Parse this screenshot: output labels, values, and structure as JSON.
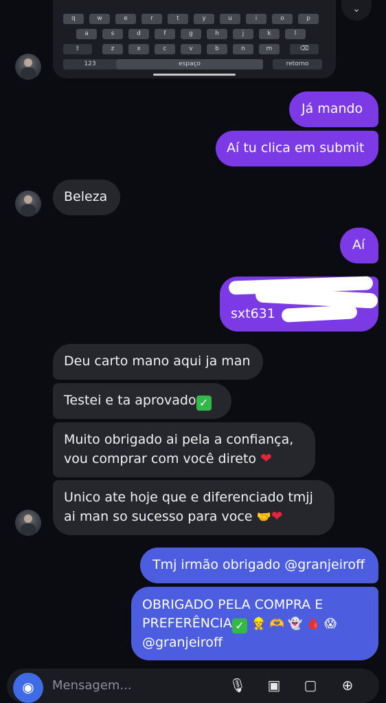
{
  "keyboard": {
    "row1": [
      "q",
      "w",
      "e",
      "r",
      "t",
      "y",
      "u",
      "i",
      "o",
      "p"
    ],
    "row2": [
      "a",
      "s",
      "d",
      "f",
      "g",
      "h",
      "j",
      "k",
      "l"
    ],
    "row3": [
      "z",
      "x",
      "c",
      "v",
      "b",
      "n",
      "m"
    ],
    "shift": "⇧",
    "backspace": "⌫",
    "numbers": "123",
    "space": "espaço",
    "return": "retorno"
  },
  "top_arrow": "⌄",
  "messages": [
    {
      "id": "m1",
      "side": "sent",
      "text": "Já mando"
    },
    {
      "id": "m2",
      "side": "sent",
      "text": "Aí tu clica em submit"
    },
    {
      "id": "m3",
      "side": "received",
      "text": "Beleza"
    },
    {
      "id": "m4",
      "side": "sent",
      "text": "Aí"
    },
    {
      "id": "m5",
      "side": "sent",
      "text_visible": "sxt631"
    },
    {
      "id": "m6",
      "side": "received",
      "text": "Deu carto mano aqui ja man"
    },
    {
      "id": "m7",
      "side": "received",
      "text": "Testei e ta aprovado"
    },
    {
      "id": "m8",
      "side": "received",
      "line1": "Muito obrigado ai pela a confiança,",
      "line2": "vou comprar com você direto"
    },
    {
      "id": "m9",
      "side": "received",
      "line1": "Unico ate hoje que e diferenciado tmjj",
      "line2": "ai man so sucesso para voce"
    },
    {
      "id": "m10",
      "side": "sent",
      "text": "Tmj irmão obrigado @granjeiroff"
    },
    {
      "id": "m11",
      "side": "sent",
      "line1": "OBRIGADO PELA COMPRA E",
      "line2": "PREFERÊNCIA",
      "line3": "@granjeiroff"
    }
  ],
  "emoji": {
    "check": "✓",
    "heart": "❤",
    "handshake": "🤝",
    "m11_emojis": "👷 🫶 👻 🩸 😱"
  },
  "composer": {
    "placeholder": "Mensagem...",
    "camera_icon": "camera-icon",
    "mic_icon": "microphone-icon",
    "gallery_icon": "gallery-icon",
    "sticker_icon": "sticker-icon",
    "add_icon": "plus-circle-icon"
  },
  "colors": {
    "background": "#0b0c12",
    "received_bubble": "#26272d",
    "sent_purple": "#7b3ae6",
    "sent_blue": "#4d5de0",
    "camera_button": "#3f6be6"
  }
}
